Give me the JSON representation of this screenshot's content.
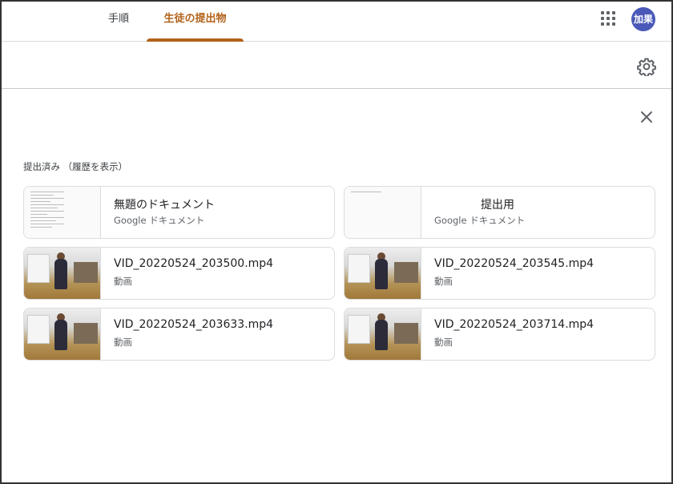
{
  "tabs": [
    {
      "label": "手順",
      "active": false
    },
    {
      "label": "生徒の提出物",
      "active": true
    }
  ],
  "user": {
    "avatar_text": "加果",
    "avatar_color": "#4a59b8"
  },
  "accent_color": "#b2621a",
  "icons": {
    "apps": "apps-grid-icon",
    "settings": "gear-icon",
    "close": "close-icon"
  },
  "submission": {
    "status_text": "提出済み （履歴を表示）",
    "files": [
      {
        "title": "無題のドキュメント",
        "type": "Google ドキュメント",
        "kind": "doc"
      },
      {
        "title": "提出用",
        "type": "Google ドキュメント",
        "kind": "doc"
      },
      {
        "title": "VID_20220524_203500.mp4",
        "type": "動画",
        "kind": "video"
      },
      {
        "title": "VID_20220524_203545.mp4",
        "type": "動画",
        "kind": "video"
      },
      {
        "title": "VID_20220524_203633.mp4",
        "type": "動画",
        "kind": "video"
      },
      {
        "title": "VID_20220524_203714.mp4",
        "type": "動画",
        "kind": "video"
      }
    ]
  }
}
